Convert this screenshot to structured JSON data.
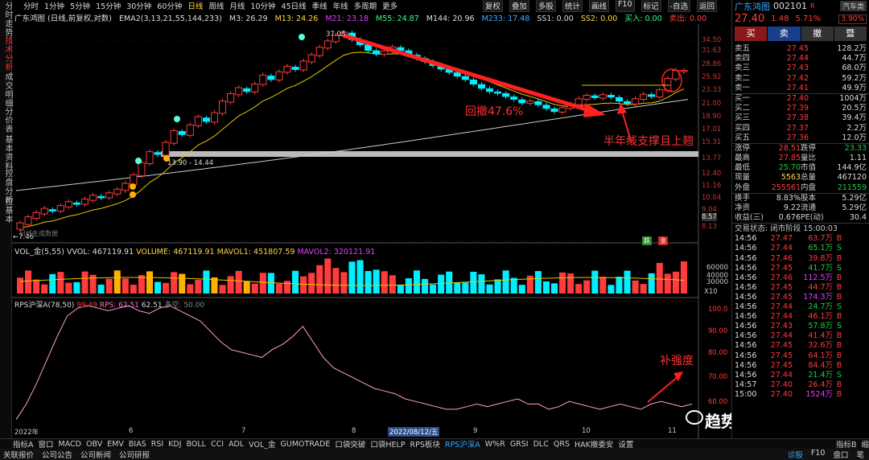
{
  "left_tabs": [
    {
      "label": "分时走势"
    },
    {
      "label": "技术分析"
    },
    {
      "label": "成交明细"
    },
    {
      "label": "分价表"
    },
    {
      "label": "基本资料"
    },
    {
      "label": "控盘分析"
    },
    {
      "label": "控基本"
    }
  ],
  "period_tabs": [
    "分时",
    "1分钟",
    "5分钟",
    "15分钟",
    "30分钟",
    "60分钟",
    "日线",
    "周线",
    "月线",
    "10分钟",
    "45日线",
    "季线",
    "年线",
    "多周期",
    "更多"
  ],
  "period_active": "日线",
  "toolbar_right": [
    "复权",
    "叠加",
    "多股",
    "统计",
    "画线",
    "F10",
    "标记",
    "-自选",
    "返回"
  ],
  "ma_line": {
    "title": "广东鸿图 (日线,前复权,对数)",
    "ema": "EMA2(3,13,21,55,144,233)",
    "m3": "M3: 26.29",
    "m13": "M13: 24.26",
    "m21": "M21: 23.18",
    "m55": "M55: 24.87",
    "m144": "M144: 20.96",
    "m233": "M233: 17.48",
    "ss1": "SS1: 0.00",
    "ss2": "SS2: 0.00",
    "buy": "买入: 0.00",
    "sell": "卖出: 0.00"
  },
  "price_axis": [
    "34.50",
    "31.63",
    "28.86",
    "25.92",
    "23.33",
    "21.00",
    "18.90",
    "17.01",
    "15.31",
    "13.77",
    "12.40",
    "11.16",
    "10.04",
    "9.04",
    "8.57",
    "8.13"
  ],
  "price_markers": {
    "high": "37.08",
    "low": "←7.46",
    "range": "13.90 - 14.44",
    "daily_badge": "日线生成数据"
  },
  "chart_annotations": {
    "retrace": "回撤47.6%",
    "support": "半年线支撑且上翘",
    "rps_note": "补强度"
  },
  "signals": {
    "up": "跌",
    "mid": "涨"
  },
  "vol_header": {
    "title": "VOL_金(5,55)",
    "vvol": "VVOL: 467119.91",
    "volume": "VOLUME: 467119.91",
    "mavol1": "MAVOL1: 451807.59",
    "mavol2": "MAVOL2: 320121.91"
  },
  "vol_axis": [
    "60000",
    "40000",
    "30000"
  ],
  "vol_unit": "X10",
  "rps_header": {
    "title": "RPS沪深A(78,50)",
    "v1": "99.49",
    "rps": "RPS: 62.51",
    "v2": "62.51",
    "duokong": "多空: 50.00"
  },
  "rps_axis": [
    "100.0",
    "90.00",
    "80.00",
    "70.00",
    "60.00"
  ],
  "x_axis": {
    "start": "2022年",
    "m6": "6",
    "m7": "7",
    "m8": "8",
    "cursor_date": "2022/08/12/五",
    "m9": "9",
    "m10": "10",
    "m11": "11"
  },
  "chart_data": {
    "type": "candlestick",
    "title": "广东鸿图 (日线,前复权,对数)",
    "y_scale": "log",
    "ylim": [
      7.46,
      37.08
    ],
    "annotations": [
      "回撤47.6%",
      "半年线支撑且上翘",
      "补强度"
    ],
    "candles": [
      [
        7.8,
        8.2
      ],
      [
        8.1,
        8.6
      ],
      [
        8.5,
        8.9
      ],
      [
        8.8,
        9.2
      ],
      [
        9.1,
        9.0
      ],
      [
        9.0,
        9.4
      ],
      [
        9.3,
        9.7
      ],
      [
        9.6,
        9.5
      ],
      [
        9.5,
        9.9
      ],
      [
        9.8,
        10.2
      ],
      [
        10.1,
        10.0
      ],
      [
        10.0,
        10.4
      ],
      [
        10.3,
        10.7
      ],
      [
        10.6,
        11.2
      ],
      [
        11.1,
        12.0
      ],
      [
        11.9,
        13.2
      ],
      [
        13.1,
        14.4
      ],
      [
        14.3,
        14.1
      ],
      [
        14.0,
        15.5
      ],
      [
        15.4,
        17.0
      ],
      [
        16.9,
        16.5
      ],
      [
        16.4,
        17.8
      ],
      [
        17.7,
        19.0
      ],
      [
        18.8,
        18.3
      ],
      [
        18.2,
        19.6
      ],
      [
        19.5,
        21.5
      ],
      [
        21.3,
        22.8
      ],
      [
        22.6,
        23.9
      ],
      [
        23.7,
        23.2
      ],
      [
        23.1,
        24.6
      ],
      [
        24.5,
        26.4
      ],
      [
        26.2,
        25.5
      ],
      [
        25.4,
        27.1
      ],
      [
        27.0,
        28.3
      ],
      [
        28.1,
        27.6
      ],
      [
        27.5,
        29.5
      ],
      [
        29.3,
        31.0
      ],
      [
        30.8,
        32.9
      ],
      [
        32.7,
        34.6
      ],
      [
        34.4,
        36.2
      ],
      [
        36.0,
        37.08
      ],
      [
        36.8,
        35.0
      ],
      [
        34.9,
        33.6
      ],
      [
        33.5,
        32.1
      ],
      [
        32.0,
        31.2
      ],
      [
        31.1,
        32.0
      ],
      [
        31.9,
        33.0
      ],
      [
        32.8,
        32.1
      ],
      [
        32.0,
        31.0
      ],
      [
        30.9,
        30.2
      ],
      [
        30.1,
        29.4
      ],
      [
        29.3,
        28.5
      ],
      [
        28.4,
        27.7
      ],
      [
        27.6,
        27.0
      ],
      [
        26.9,
        26.2
      ],
      [
        26.1,
        25.5
      ],
      [
        25.4,
        24.6
      ],
      [
        24.5,
        23.8
      ],
      [
        23.7,
        23.2
      ],
      [
        23.1,
        22.9
      ],
      [
        22.8,
        22.3
      ],
      [
        22.2,
        21.8
      ],
      [
        21.7,
        21.2
      ],
      [
        21.1,
        21.5
      ],
      [
        21.4,
        20.9
      ],
      [
        20.8,
        20.3
      ],
      [
        20.2,
        19.8
      ],
      [
        19.7,
        20.4
      ],
      [
        20.3,
        21.0
      ],
      [
        20.9,
        21.9
      ],
      [
        21.8,
        22.5
      ],
      [
        22.4,
        22.1
      ],
      [
        22.0,
        22.6
      ],
      [
        22.5,
        22.2
      ],
      [
        22.1,
        21.5
      ],
      [
        21.4,
        21.1
      ],
      [
        21.0,
        21.9
      ],
      [
        21.8,
        22.7
      ],
      [
        22.6,
        22.3
      ],
      [
        22.2,
        23.5
      ],
      [
        23.4,
        25.7
      ],
      [
        25.6,
        27.4
      ],
      [
        27.3,
        27.4
      ]
    ],
    "rps": [
      56,
      62,
      70,
      79,
      88,
      96,
      99,
      100,
      99,
      98,
      99,
      100,
      98,
      97,
      99,
      100,
      98,
      96,
      94,
      90,
      86,
      83,
      82,
      81,
      80,
      83,
      85,
      88,
      92,
      86,
      80,
      76,
      74,
      72,
      70,
      68,
      67,
      66,
      64,
      63,
      62,
      61,
      60,
      60,
      61,
      62,
      61,
      62,
      63,
      64,
      62,
      62,
      60,
      61,
      63,
      62,
      61,
      60,
      61,
      62,
      61,
      60,
      62,
      63,
      62,
      61,
      62
    ]
  },
  "panel": {
    "name": "广东鸿图",
    "code": "002101",
    "flag": "R",
    "sector": "汽车类",
    "price": "27.40",
    "change": "1.48",
    "pct": "5.71%",
    "buttons": [
      "买",
      "卖",
      "撤",
      "暨"
    ],
    "asks": [
      {
        "l": "卖五",
        "p": "27.45",
        "v": "128.2万"
      },
      {
        "l": "卖四",
        "p": "27.44",
        "v": "44.7万"
      },
      {
        "l": "卖三",
        "p": "27.43",
        "v": "68.0万"
      },
      {
        "l": "卖二",
        "p": "27.42",
        "v": "59.2万"
      },
      {
        "l": "卖一",
        "p": "27.41",
        "v": "49.9万"
      }
    ],
    "bids": [
      {
        "l": "买一",
        "p": "27.40",
        "v": "1004万"
      },
      {
        "l": "买二",
        "p": "27.39",
        "v": "20.5万"
      },
      {
        "l": "买三",
        "p": "27.38",
        "v": "39.4万"
      },
      {
        "l": "买四",
        "p": "27.37",
        "v": "2.2万"
      },
      {
        "l": "买五",
        "p": "27.36",
        "v": "12.0万"
      }
    ],
    "stats": [
      {
        "a": "涨停",
        "b": "28.51",
        "c": "跌停",
        "d": "23.33"
      },
      {
        "a": "最高",
        "b": "27.85",
        "c": "量比",
        "d": "1.11"
      },
      {
        "a": "最低",
        "b": "25.70",
        "c": "市值",
        "d": "144.9亿"
      },
      {
        "a": "现量",
        "b": "5563",
        "c": "总量",
        "d": "467120"
      },
      {
        "a": "外盘",
        "b": "255561",
        "c": "内盘",
        "d": "211559"
      }
    ],
    "stats2": [
      {
        "a": "换手",
        "b": "8.83%",
        "c": "股本",
        "d": "5.29亿"
      },
      {
        "a": "净资",
        "b": "9.22",
        "c": "流通",
        "d": "5.29亿"
      },
      {
        "a": "收益(三)",
        "b": "0.676",
        "c": "PE(动)",
        "d": "30.4"
      }
    ],
    "trade_status": "交易状态: 闭市阶段 15:00:03",
    "ticks": [
      [
        "14:56",
        "27.47",
        "63.7万",
        "B"
      ],
      [
        "14:56",
        "27.44",
        "65.1万",
        "S"
      ],
      [
        "14:56",
        "27.46",
        "39.8万",
        "B"
      ],
      [
        "14:56",
        "27.45",
        "41.7万",
        "S"
      ],
      [
        "14:56",
        "27.46",
        "112.5万",
        "B"
      ],
      [
        "14:56",
        "27.45",
        "44.7万",
        "B"
      ],
      [
        "14:56",
        "27.45",
        "174.3万",
        "B"
      ],
      [
        "14:56",
        "27.44",
        "24.7万",
        "S"
      ],
      [
        "14:56",
        "27.44",
        "46.1万",
        "B"
      ],
      [
        "14:56",
        "27.43",
        "57.8万",
        "S"
      ],
      [
        "14:56",
        "27.44",
        "41.4万",
        "B"
      ],
      [
        "14:56",
        "27.45",
        "32.6万",
        "B"
      ],
      [
        "14:56",
        "27.45",
        "64.1万",
        "B"
      ],
      [
        "14:56",
        "27.45",
        "84.4万",
        "B"
      ],
      [
        "14:56",
        "27.44",
        "21.4万",
        "S"
      ],
      [
        "14:57",
        "27.40",
        "26.4万",
        "B"
      ],
      [
        "15:00",
        "27.40",
        "1524万",
        "B"
      ]
    ]
  },
  "bottom_tabs": [
    "指标A",
    "窗口",
    "MACD",
    "OBV",
    "EMV",
    "BIAS",
    "RSI",
    "KDJ",
    "BOLL",
    "CCI",
    "ADL",
    "VOL_金",
    "GUMOTRADE",
    "口袋突破",
    "口袋HELP",
    "RPS板块",
    "RPS沪深A",
    "W%R",
    "GRSI",
    "DLC",
    "QRS",
    "HAK撤委安",
    "设置",
    "指标B",
    "缩"
  ],
  "bottom_active": "RPS沪深A",
  "status_bar": [
    "关联报价",
    "公司公告",
    "公司新闻",
    "公司研报"
  ],
  "status_right": [
    "诊股",
    "F10",
    "盘口",
    "笔"
  ],
  "watermark": "趋势一阳指"
}
